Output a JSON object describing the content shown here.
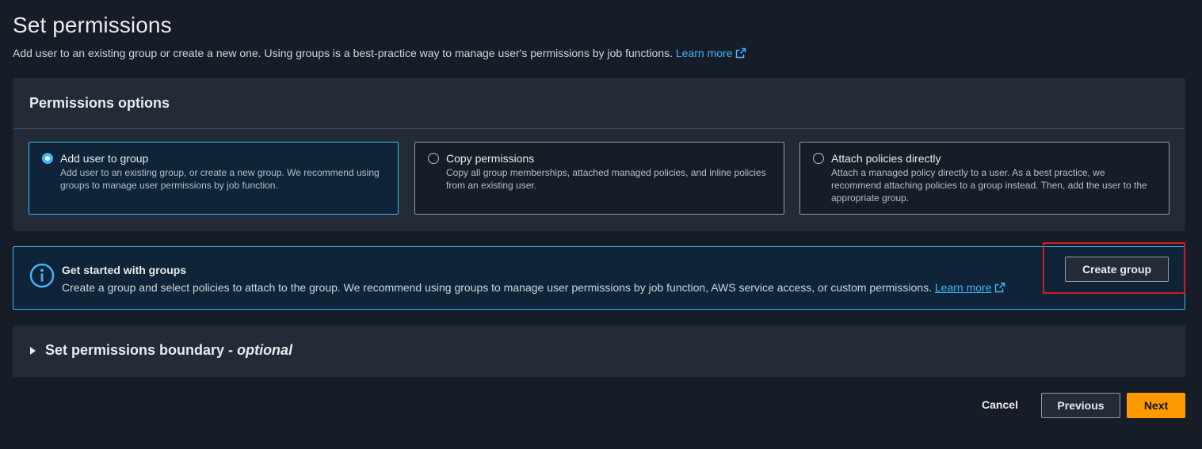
{
  "page": {
    "title": "Set permissions",
    "description": "Add user to an existing group or create a new one. Using groups is a best-practice way to manage user's permissions by job functions.",
    "learn_more": "Learn more"
  },
  "permissions_options": {
    "title": "Permissions options",
    "options": [
      {
        "label": "Add user to group",
        "description": "Add user to an existing group, or create a new group. We recommend using groups to manage user permissions by job function.",
        "selected": true
      },
      {
        "label": "Copy permissions",
        "description": "Copy all group memberships, attached managed policies, and inline policies from an existing user.",
        "selected": false
      },
      {
        "label": "Attach policies directly",
        "description": "Attach a managed policy directly to a user. As a best practice, we recommend attaching policies to a group instead. Then, add the user to the appropriate group.",
        "selected": false
      }
    ]
  },
  "groups_alert": {
    "icon": "info-icon",
    "title": "Get started with groups",
    "description": "Create a group and select policies to attach to the group. We recommend using groups to manage user permissions by job function, AWS service access, or custom permissions.",
    "learn_more": "Learn more",
    "button_label": "Create group"
  },
  "boundary": {
    "title": "Set permissions boundary -",
    "optional": "optional",
    "expanded": false
  },
  "footer": {
    "cancel": "Cancel",
    "previous": "Previous",
    "next": "Next"
  },
  "colors": {
    "background": "#161d26",
    "panel": "#232b37",
    "accent_link": "#42b4ff",
    "primary_button": "#ff9900",
    "highlight_box": "#d11c26"
  }
}
